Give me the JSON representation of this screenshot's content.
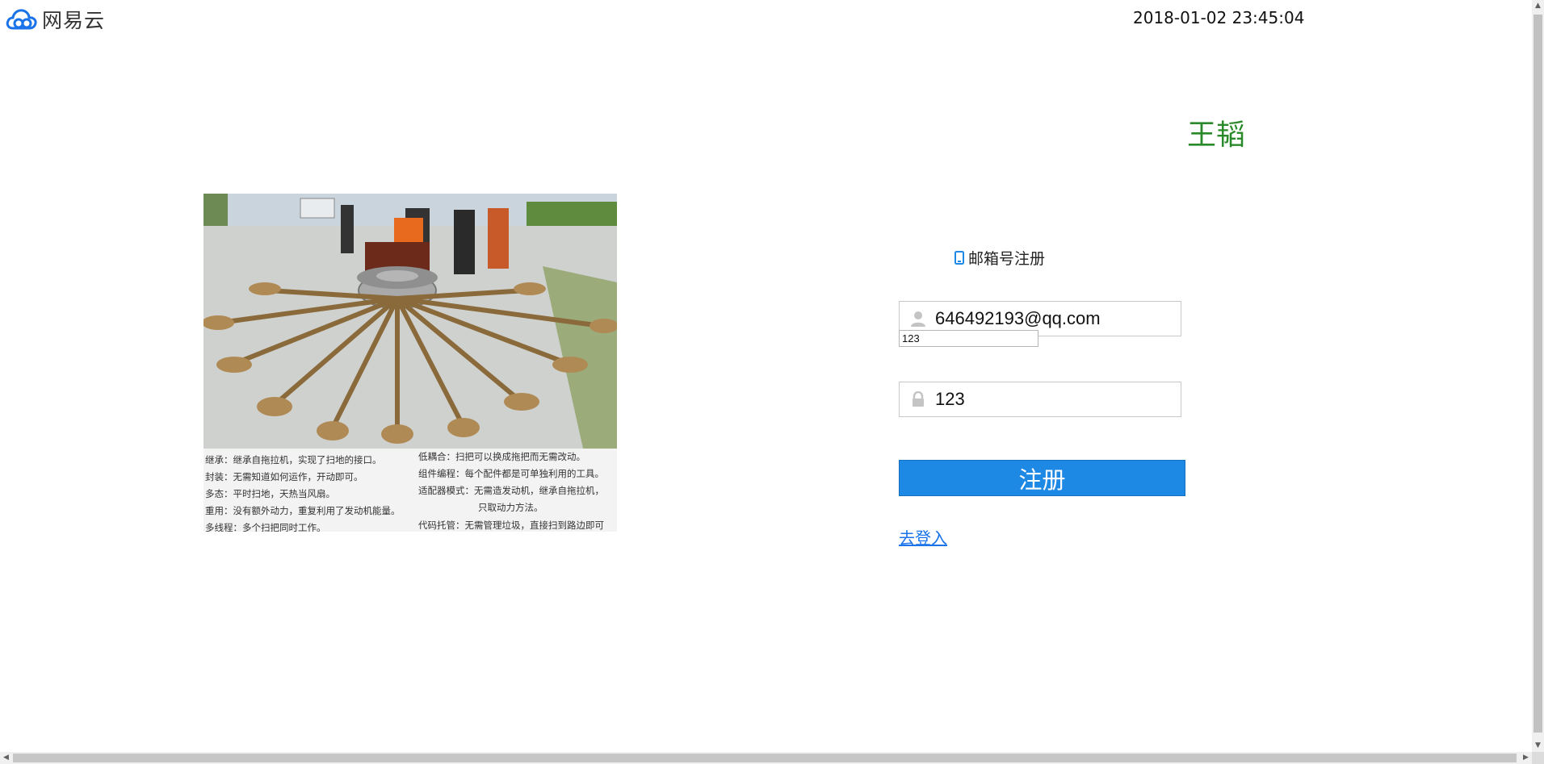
{
  "brand": {
    "name": "网易云",
    "logo_icon": "cloud-logo-icon",
    "color": "#1a73e8"
  },
  "header": {
    "datetime": "2018-01-02 23:45:04",
    "username": "王韬"
  },
  "promo_image": {
    "caption_left": [
      "继承：继承自拖拉机，实现了扫地的接口。",
      "封装：无需知道如何运作，开动即可。",
      "多态：平时扫地，天热当风扇。",
      "重用：没有额外动力，重复利用了发动机能量。",
      "多线程：多个扫把同时工作。"
    ],
    "caption_right": [
      "低耦合：扫把可以换成拖把而无需改动。",
      "组件编程：每个配件都是可单独利用的工具。",
      "适配器模式：无需造发动机，继承自拖拉机，",
      "只取动力方法。",
      "代码托管：无需管理垃圾，直接扫到路边即可"
    ]
  },
  "form": {
    "tab_label": "邮箱号注册",
    "tab_icon": "phone-icon",
    "email_value": "646492193@qq.com",
    "email_icon": "user-icon",
    "autocomplete_suggestion": "123",
    "password_value": "123",
    "password_icon": "lock-icon",
    "register_label": "注册",
    "login_link": "去登入"
  },
  "colors": {
    "accent": "#1e88e5",
    "username": "#2a8a2a",
    "link": "#1a73e8"
  }
}
